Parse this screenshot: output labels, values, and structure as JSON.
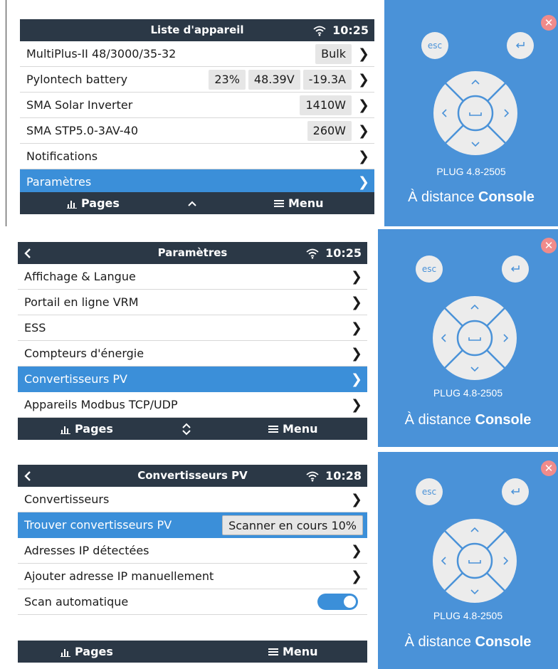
{
  "colors": {
    "bar": "#2b3846",
    "selected": "#3b8fd9",
    "remote_bg": "#4a92d8",
    "close": "#f08b8b"
  },
  "panels": [
    {
      "title": "Liste d'appareil",
      "time": "10:25",
      "rows": [
        {
          "label": "MultiPlus-II 48/3000/35-32",
          "values": [
            "Bulk"
          ]
        },
        {
          "label": "Pylontech battery",
          "values": [
            "23%",
            "48.39V",
            "-19.3A"
          ]
        },
        {
          "label": "SMA Solar Inverter",
          "values": [
            "1410W"
          ]
        },
        {
          "label": "SMA STP5.0-3AV-40",
          "values": [
            "260W"
          ]
        },
        {
          "label": "Notifications",
          "values": []
        },
        {
          "label": "Paramètres",
          "values": []
        }
      ],
      "bottom": {
        "pages": "Pages",
        "menu": "Menu"
      }
    },
    {
      "title": "Paramètres",
      "time": "10:25",
      "rows": [
        {
          "label": "Affichage & Langue"
        },
        {
          "label": "Portail en ligne VRM"
        },
        {
          "label": "ESS"
        },
        {
          "label": "Compteurs d'énergie"
        },
        {
          "label": "Convertisseurs PV"
        },
        {
          "label": "Appareils Modbus TCP/UDP"
        }
      ],
      "bottom": {
        "pages": "Pages",
        "menu": "Menu"
      }
    },
    {
      "title": "Convertisseurs PV",
      "time": "10:28",
      "rows": [
        {
          "label": "Convertisseurs"
        },
        {
          "label": "Trouver convertisseurs PV",
          "value": "Scanner en cours 10%"
        },
        {
          "label": "Adresses IP détectées"
        },
        {
          "label": "Ajouter adresse IP manuellement"
        },
        {
          "label": "Scan automatique",
          "toggle_on": true
        }
      ],
      "bottom": {
        "pages": "Pages",
        "menu": "Menu"
      }
    }
  ],
  "remote": {
    "esc_label": "esc",
    "model": "PLUG 4.8-2505",
    "brand_prefix": "À distance",
    "brand_name": "Console",
    "close_symbol": "✕"
  }
}
